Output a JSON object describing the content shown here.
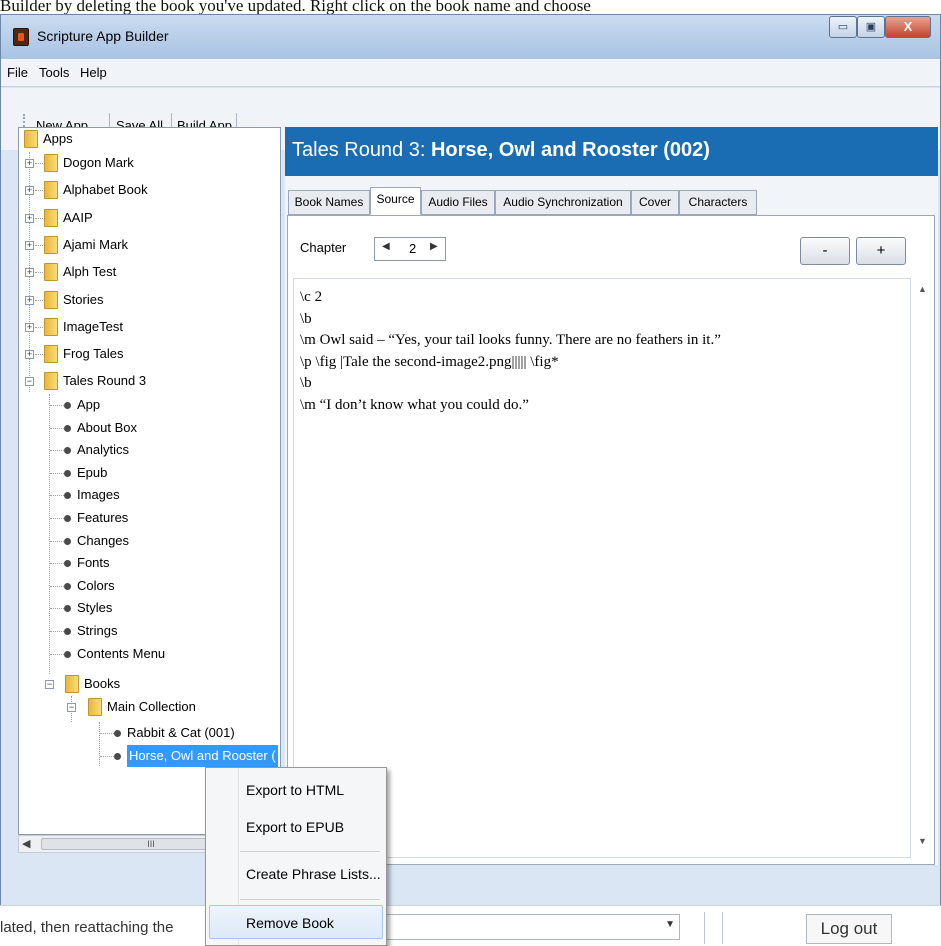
{
  "background_text": "Builder by deleting the book you've updated. Right click on the book name and choose",
  "window": {
    "title": "Scripture App Builder",
    "min_glyph": "▭",
    "max_glyph": "▣",
    "close_glyph": "X"
  },
  "menu": {
    "file": "File",
    "tools": "Tools",
    "help": "Help"
  },
  "toolbar": {
    "new_app": "New App...",
    "save_all": "Save All",
    "build_app": "Build App"
  },
  "tree": {
    "root": "Apps",
    "apps": [
      "Dogon Mark",
      "Alphabet Book",
      "AAIP",
      "Ajami Mark",
      "Alph Test",
      "Stories",
      "ImageTest",
      "Frog Tales"
    ],
    "open_app": "Tales Round 3",
    "settings": [
      "App",
      "About Box",
      "Analytics",
      "Epub",
      "Images",
      "Features",
      "Changes",
      "Fonts",
      "Colors",
      "Styles",
      "Strings",
      "Contents Menu"
    ],
    "books_folder": "Books",
    "collection": "Main Collection",
    "books": [
      "Rabbit & Cat (001)",
      "Horse, Owl and Rooster ("
    ],
    "selected_book_index": 1,
    "scroll_thumb_glyph": "III"
  },
  "book_header": {
    "prefix": "Tales Round 3: ",
    "name": "Horse, Owl and Rooster  (002)"
  },
  "tabs": [
    "Book Names",
    "Source",
    "Audio Files",
    "Audio Synchronization",
    "Cover",
    "Characters"
  ],
  "active_tab": "Source",
  "chapter": {
    "label": "Chapter",
    "value": "2",
    "minus": "-",
    "plus": "+"
  },
  "source_lines": [
    "\\c 2",
    "\\b",
    "\\m Owl said – “Yes, your tail looks funny. There are no feathers in it.”",
    "\\p \\fig |Tale the second-image2.png||||| \\fig*",
    "\\b",
    "\\m “I don’t know what you could do.”"
  ],
  "context_menu": {
    "items": [
      "Export to HTML",
      "Export to EPUB",
      "Create Phrase Lists...",
      "Remove Book"
    ],
    "hovered": "Remove Book"
  },
  "bottom": {
    "text": "lated, then reattaching the",
    "logout": "Log out"
  },
  "colors": {
    "header_blue": "#1a6db2",
    "selection": "#3399ff"
  }
}
